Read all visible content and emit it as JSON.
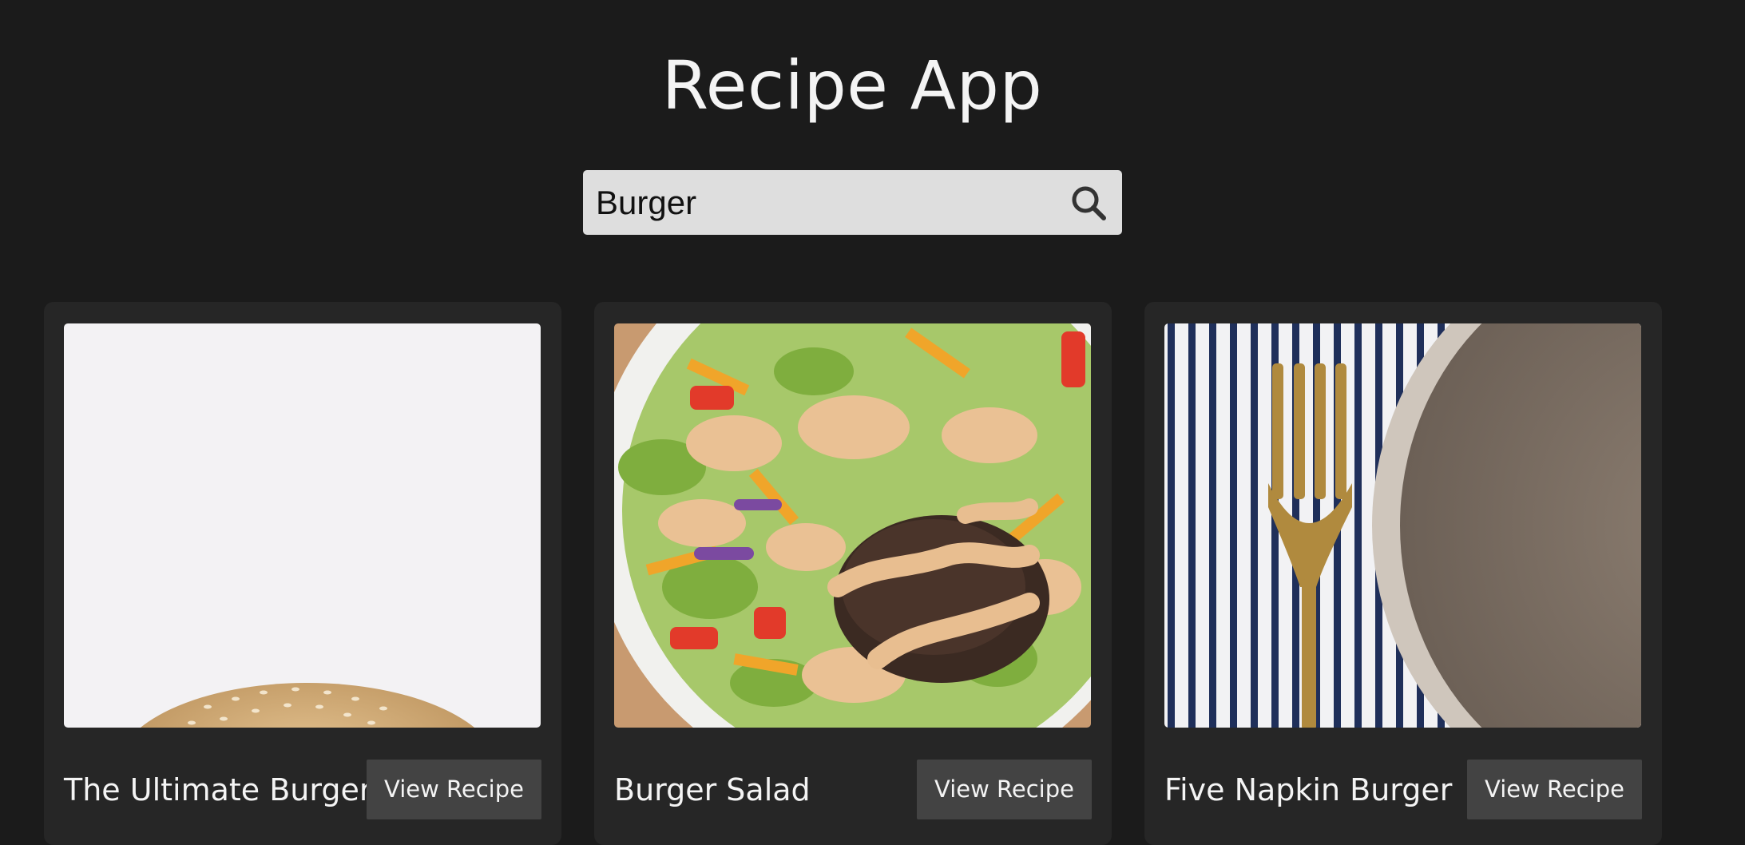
{
  "header": {
    "title": "Recipe App"
  },
  "search": {
    "value": "Burger",
    "icon": "search-icon"
  },
  "recipes": [
    {
      "title": "The Ultimate Burger",
      "button_label": "View Recipe"
    },
    {
      "title": "Burger Salad",
      "button_label": "View Recipe"
    },
    {
      "title": "Five Napkin Burger",
      "button_label": "View Recipe"
    }
  ],
  "colors": {
    "background": "#1b1b1b",
    "card": "#262626",
    "button": "#434343",
    "search_bg": "#dedede"
  }
}
